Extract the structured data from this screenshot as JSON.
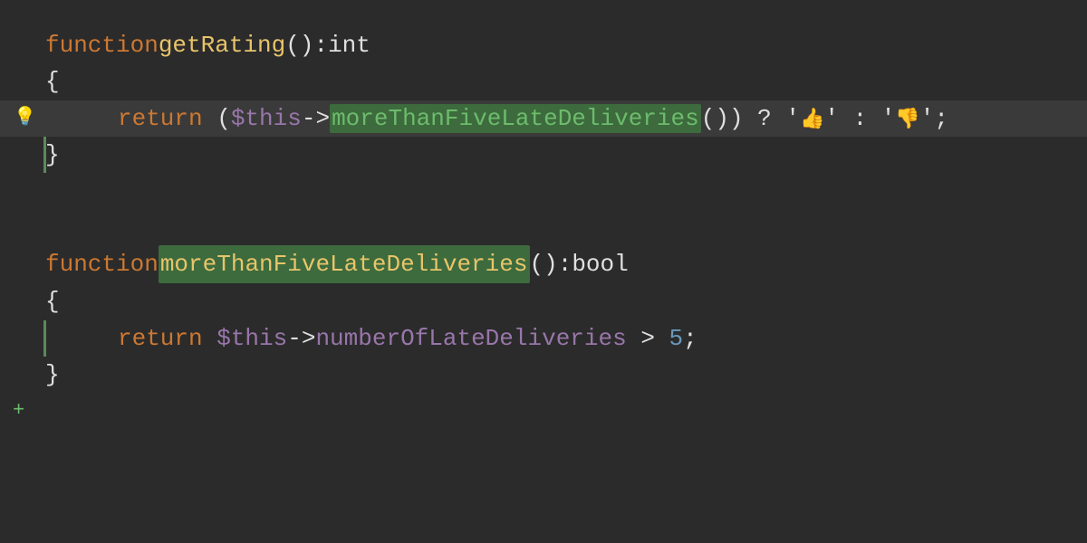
{
  "editor": {
    "background": "#2b2b2b",
    "lines": [
      {
        "id": "line1",
        "type": "code",
        "highlighted": false,
        "hasBulb": false,
        "hasLeftBorder": false,
        "indent": 0,
        "tokens": [
          {
            "type": "kw-function",
            "text": "function "
          },
          {
            "type": "fn-name",
            "text": "getRating"
          },
          {
            "type": "paren",
            "text": "(): "
          },
          {
            "type": "type-int",
            "text": "int"
          }
        ]
      },
      {
        "id": "line2",
        "type": "code",
        "highlighted": false,
        "hasBulb": false,
        "hasLeftBorder": false,
        "indent": 0,
        "tokens": [
          {
            "type": "brace",
            "text": "{"
          }
        ]
      },
      {
        "id": "line3",
        "type": "code",
        "highlighted": true,
        "hasBulb": true,
        "hasLeftBorder": false,
        "indent": 1,
        "tokens": [
          {
            "type": "kw-return",
            "text": "return "
          },
          {
            "type": "paren",
            "text": "("
          },
          {
            "type": "variable",
            "text": "$this"
          },
          {
            "type": "arrow",
            "text": "->"
          },
          {
            "type": "method-highlight",
            "text": "moreThanFiveLateDeliveries"
          },
          {
            "type": "paren",
            "text": "()) ? '"
          },
          {
            "type": "emoji",
            "text": "👍"
          },
          {
            "type": "paren",
            "text": "' : '"
          },
          {
            "type": "emoji",
            "text": "👎"
          },
          {
            "type": "paren",
            "text": "';"
          }
        ]
      },
      {
        "id": "line4",
        "type": "code",
        "highlighted": false,
        "hasBulb": false,
        "hasLeftBorder": true,
        "indent": 0,
        "tokens": [
          {
            "type": "brace",
            "text": "}"
          }
        ]
      },
      {
        "id": "line5",
        "type": "empty"
      },
      {
        "id": "line6",
        "type": "empty"
      },
      {
        "id": "line7",
        "type": "code",
        "highlighted": false,
        "hasBulb": false,
        "hasLeftBorder": false,
        "indent": 0,
        "tokens": [
          {
            "type": "kw-function",
            "text": "function "
          },
          {
            "type": "fn-name-highlight",
            "text": "moreThanFiveLateDeliveries"
          },
          {
            "type": "paren",
            "text": "(): "
          },
          {
            "type": "type-bool",
            "text": "bool"
          }
        ]
      },
      {
        "id": "line8",
        "type": "code",
        "highlighted": false,
        "hasBulb": false,
        "hasLeftBorder": false,
        "indent": 0,
        "tokens": [
          {
            "type": "brace",
            "text": "{"
          }
        ]
      },
      {
        "id": "line9",
        "type": "code",
        "highlighted": false,
        "hasBulb": false,
        "hasLeftBorder": true,
        "indent": 1,
        "tokens": [
          {
            "type": "kw-return",
            "text": "return "
          },
          {
            "type": "variable",
            "text": "$this"
          },
          {
            "type": "arrow",
            "text": "->"
          },
          {
            "type": "property",
            "text": "numberOfLateDeliveries"
          },
          {
            "type": "operator",
            "text": " > "
          },
          {
            "type": "number",
            "text": "5"
          },
          {
            "type": "semicolon",
            "text": ";"
          }
        ]
      },
      {
        "id": "line10",
        "type": "code",
        "highlighted": false,
        "hasBulb": false,
        "hasLeftBorder": false,
        "indent": 0,
        "tokens": [
          {
            "type": "brace",
            "text": "}"
          }
        ]
      },
      {
        "id": "line11",
        "type": "bottom",
        "hasPlus": true
      }
    ]
  }
}
